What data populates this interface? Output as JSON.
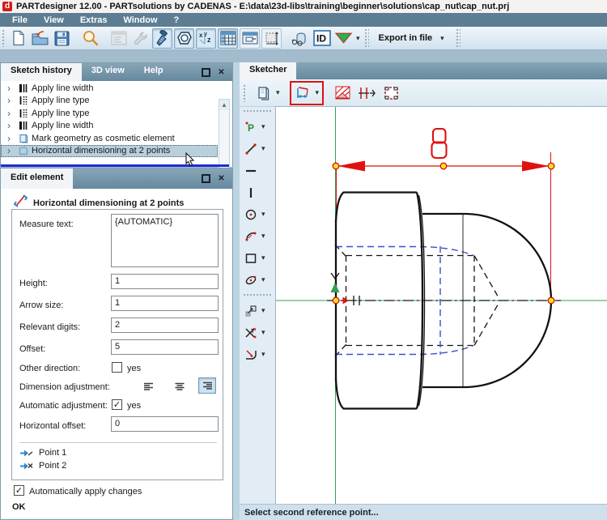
{
  "window": {
    "title": "PARTdesigner 12.00 - PARTsolutions by CADENAS - E:\\data\\23d-libs\\training\\beginner\\solutions\\cap_nut\\cap_nut.prj"
  },
  "menu": {
    "items": [
      {
        "label": "File"
      },
      {
        "label": "View"
      },
      {
        "label": "Extras"
      },
      {
        "label": "Window"
      },
      {
        "label": "?"
      }
    ]
  },
  "toolbar": {
    "id_label": "ID",
    "export_label": "Export in file"
  },
  "sketch_history": {
    "tabs": [
      {
        "label": "Sketch history"
      },
      {
        "label": "3D view"
      },
      {
        "label": "Help"
      }
    ],
    "items": [
      {
        "label": "Apply line width"
      },
      {
        "label": "Apply line type"
      },
      {
        "label": "Apply line type"
      },
      {
        "label": "Apply line width"
      },
      {
        "label": "Mark geometry as cosmetic element"
      },
      {
        "label": "Horizontal dimensioning at 2 points"
      }
    ]
  },
  "edit_element": {
    "tab": "Edit element",
    "title": "Horizontal dimensioning at 2 points",
    "fields": {
      "measure_text": {
        "label": "Measure text:",
        "value": "{AUTOMATIC}"
      },
      "height": {
        "label": "Height:",
        "value": "1"
      },
      "arrow_size": {
        "label": "Arrow size:",
        "value": "1"
      },
      "relevant_digits": {
        "label": "Relevant digits:",
        "value": "2"
      },
      "offset": {
        "label": "Offset:",
        "value": "5"
      },
      "other_direction": {
        "label": "Other direction:",
        "checkbox_label": "yes",
        "checked": false
      },
      "dimension_adjustment": {
        "label": "Dimension adjustment:",
        "selected_option": "right"
      },
      "automatic_adjustment": {
        "label": "Automatic adjustment:",
        "checkbox_label": "yes",
        "checked": true
      },
      "horizontal_offset": {
        "label": "Horizontal offset:",
        "value": "0"
      }
    },
    "points": [
      {
        "label": "Point 1"
      },
      {
        "label": "Point 2"
      }
    ],
    "apply_label": "Automatically apply changes",
    "status": "OK",
    "check_glyph": "✓"
  },
  "sketcher": {
    "tab": "Sketcher",
    "dimension_value": "8",
    "status": "Select second reference point..."
  },
  "colors": {
    "dimension_red": "#e01010",
    "axis_green": "#35a055",
    "thread_blue": "#3a50c8",
    "handle_yellow": "#ffdf1c",
    "menu_blue": "#5d7e92"
  }
}
